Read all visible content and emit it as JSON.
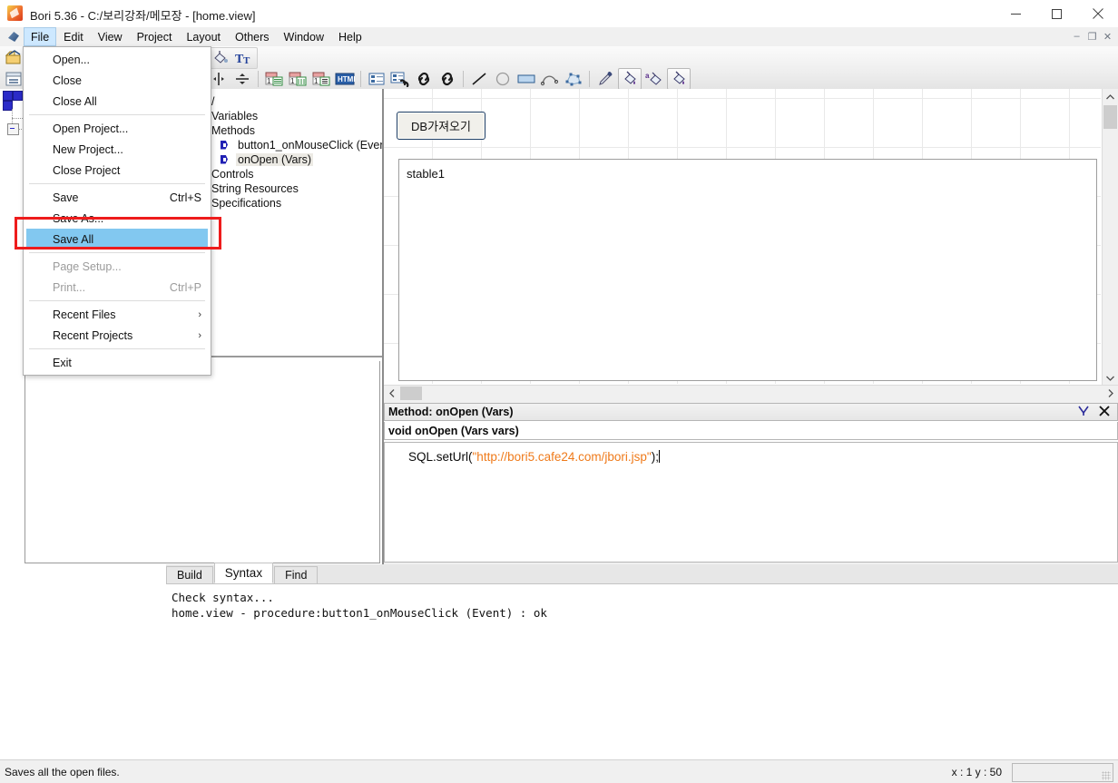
{
  "window": {
    "title": "Bori 5.36 - C:/보리강좌/메모장 - [home.view]",
    "app_icon": "bori-feather-icon",
    "minimize": "–",
    "maximize": "□",
    "close": "✕",
    "mdi_restore": "❐",
    "mdi_minimize": "–",
    "mdi_close": "✕"
  },
  "menubar": {
    "items": [
      {
        "label": "File",
        "active": true
      },
      {
        "label": "Edit",
        "active": false
      },
      {
        "label": "View",
        "active": false
      },
      {
        "label": "Project",
        "active": false
      },
      {
        "label": "Layout",
        "active": false
      },
      {
        "label": "Others",
        "active": false
      },
      {
        "label": "Window",
        "active": false
      },
      {
        "label": "Help",
        "active": false
      }
    ]
  },
  "file_menu": {
    "items": [
      {
        "label": "Open...",
        "accel": "",
        "state": "normal",
        "kind": "item"
      },
      {
        "label": "Close",
        "accel": "",
        "state": "normal",
        "kind": "item"
      },
      {
        "label": "Close All",
        "accel": "",
        "state": "normal",
        "kind": "item"
      },
      {
        "kind": "separator"
      },
      {
        "label": "Open Project...",
        "accel": "",
        "state": "normal",
        "kind": "item"
      },
      {
        "label": "New Project...",
        "accel": "",
        "state": "normal",
        "kind": "item"
      },
      {
        "label": "Close Project",
        "accel": "",
        "state": "normal",
        "kind": "item"
      },
      {
        "kind": "separator"
      },
      {
        "label": "Save",
        "accel": "Ctrl+S",
        "state": "normal",
        "kind": "item"
      },
      {
        "label": "Save As...",
        "accel": "",
        "state": "normal",
        "kind": "item"
      },
      {
        "label": "Save All",
        "accel": "",
        "state": "selected",
        "kind": "item"
      },
      {
        "kind": "separator"
      },
      {
        "label": "Page Setup...",
        "accel": "",
        "state": "disabled",
        "kind": "item"
      },
      {
        "label": "Print...",
        "accel": "Ctrl+P",
        "state": "disabled",
        "kind": "item"
      },
      {
        "kind": "separator"
      },
      {
        "label": "Recent Files",
        "accel": "",
        "state": "normal",
        "kind": "submenu"
      },
      {
        "label": "Recent Projects",
        "accel": "",
        "state": "normal",
        "kind": "submenu"
      },
      {
        "kind": "separator"
      },
      {
        "label": "Exit",
        "accel": "",
        "state": "normal",
        "kind": "item"
      }
    ],
    "highlight_color": "#82c8f0",
    "annotation_box_color": "#ee1c1c",
    "submenu_arrow": "›"
  },
  "toolbar": {
    "row1_icons": [
      "open-folder-icon",
      "paint-bucket-icon",
      "font-style-icon"
    ],
    "row2_icons": [
      "panel-icon",
      "list-view-icon",
      "grid-table-icon",
      "inner-frame-icon",
      "split-panel-icon",
      "tree-view-icon",
      "tab-folder-icon",
      "spinner-icon",
      "align-vertical-icon",
      "align-horizontal-icon",
      "calendar-field-icon",
      "combo-field-icon",
      "list-field-icon",
      "html-icon",
      "property-list-icon",
      "linked-table-icon",
      "link-icon",
      "link-alt-icon",
      "line-tool-icon",
      "ellipse-tool-icon",
      "rectangle-tool-icon",
      "polyline-tool-icon",
      "polygon-tool-icon",
      "eyedropper-icon",
      "fill-color-icon",
      "text-fill-color-icon",
      "border-fill-color-icon"
    ]
  },
  "object_tree": {
    "rows": [
      {
        "label": "/",
        "icon": "",
        "selected": false
      },
      {
        "label": "Variables",
        "icon": "",
        "selected": false
      },
      {
        "label": "Methods",
        "icon": "",
        "selected": false
      },
      {
        "label": "button1_onMouseClick (Event)",
        "icon": "event-icon",
        "selected": false
      },
      {
        "label": "onOpen (Vars)",
        "icon": "event-icon",
        "selected": true
      },
      {
        "label": "Controls",
        "icon": "",
        "selected": false
      },
      {
        "label": "String Resources",
        "icon": "",
        "selected": false
      },
      {
        "label": "Specifications",
        "icon": "",
        "selected": false
      }
    ]
  },
  "canvas": {
    "button_label": "DB가져오기",
    "table_label": "stable1",
    "scroll_left_arrow": "‹",
    "scroll_right_arrow": "›",
    "scroll_up_arrow": "⌃",
    "scroll_down_arrow": "⌄"
  },
  "method_editor": {
    "header_title": "Method: onOpen (Vars)",
    "header_icon": "branch-icon",
    "close_label": "✕",
    "signature": "void onOpen (Vars vars)",
    "code_prefix": "SQL.setUrl(",
    "code_string": "\"http://bori5.cafe24.com/jbori.jsp\"",
    "code_suffix": ");",
    "string_color": "#ef7a1a"
  },
  "output": {
    "tabs": [
      {
        "label": "Build",
        "active": false
      },
      {
        "label": "Syntax",
        "active": true
      },
      {
        "label": "Find",
        "active": false
      }
    ],
    "lines": [
      "Check syntax...",
      "home.view - procedure:button1_onMouseClick (Event) : ok"
    ]
  },
  "statusbar": {
    "hint": "Saves all the open files.",
    "coords": "x : 1  y : 50"
  }
}
